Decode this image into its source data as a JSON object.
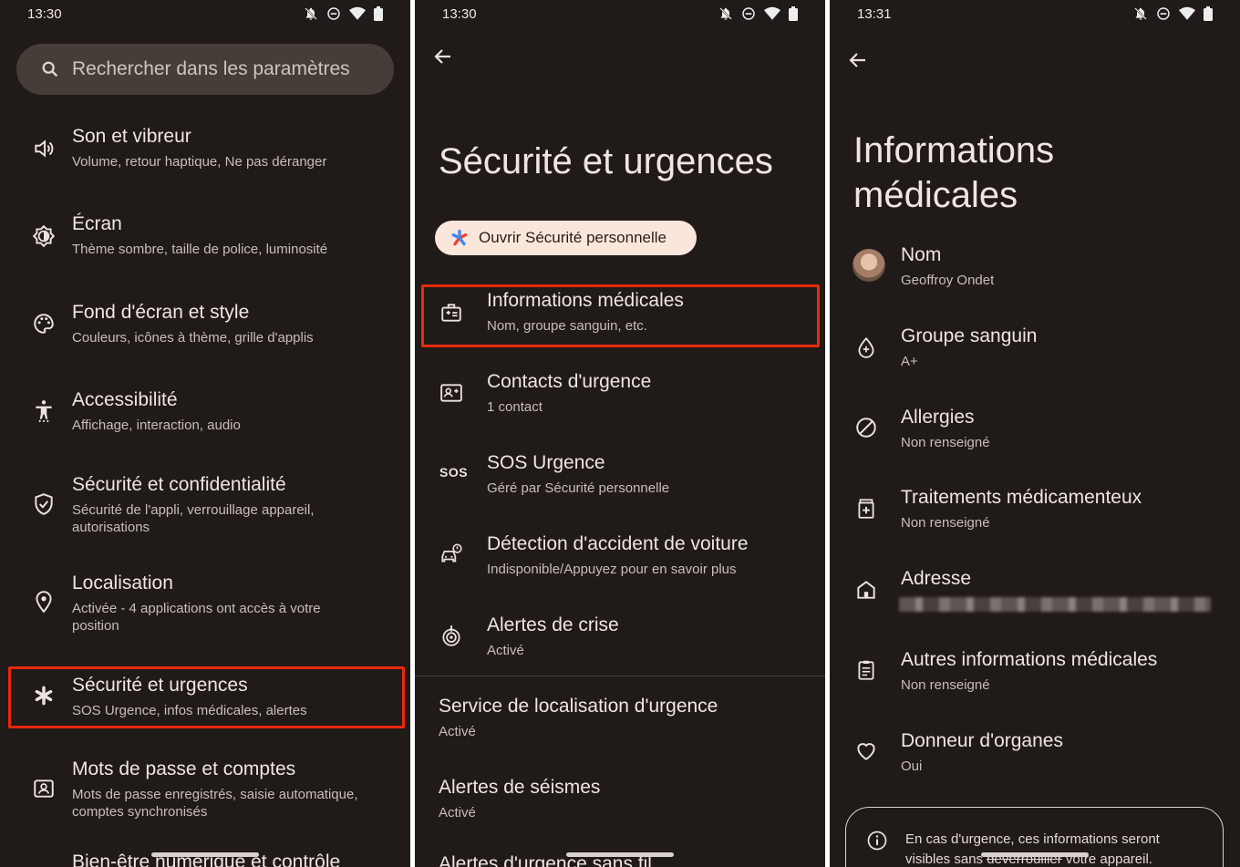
{
  "panel1": {
    "status": {
      "time": "13:30"
    },
    "search": {
      "placeholder": "Rechercher dans les paramètres"
    },
    "items": [
      {
        "title": "Son et vibreur",
        "sub": "Volume, retour haptique, Ne pas déranger",
        "icon": "volume-icon"
      },
      {
        "title": "Écran",
        "sub": "Thème sombre, taille de police, luminosité",
        "icon": "brightness-icon"
      },
      {
        "title": "Fond d'écran et style",
        "sub": "Couleurs, icônes à thème, grille d'applis",
        "icon": "palette-icon"
      },
      {
        "title": "Accessibilité",
        "sub": "Affichage, interaction, audio",
        "icon": "accessibility-icon"
      },
      {
        "title": "Sécurité et confidentialité",
        "sub": "Sécurité de l'appli, verrouillage appareil,",
        "sub2": "autorisations",
        "icon": "shield-icon"
      },
      {
        "title": "Localisation",
        "sub": "Activée - 4 applications ont accès à votre",
        "sub2": "position",
        "icon": "location-icon"
      },
      {
        "title": "Sécurité et urgences",
        "sub": "SOS Urgence, infos médicales, alertes",
        "icon": "asterisk-icon"
      },
      {
        "title": "Mots de passe et comptes",
        "sub": "Mots de passe enregistrés, saisie automatique,",
        "sub2": "comptes synchronisés",
        "icon": "account-box-icon"
      },
      {
        "title": "Bien-être numérique et contrôle",
        "icon": ""
      }
    ]
  },
  "panel2": {
    "status": {
      "time": "13:30"
    },
    "title": "Sécurité et urgences",
    "pill": "Ouvrir Sécurité personnelle",
    "items": [
      {
        "title": "Informations médicales",
        "sub": "Nom, groupe sanguin, etc.",
        "icon": "medical-id-icon"
      },
      {
        "title": "Contacts d'urgence",
        "sub": "1 contact",
        "icon": "contact-card-icon"
      },
      {
        "title": "SOS Urgence",
        "sub": "Géré par Sécurité personnelle",
        "icon": "sos-icon",
        "icon_text": "SOS"
      },
      {
        "title": "Détection d'accident de voiture",
        "sub": "Indisponible/Appuyez pour en savoir plus",
        "icon": "car-crash-icon"
      },
      {
        "title": "Alertes de crise",
        "sub": "Activé",
        "icon": "crisis-alert-icon"
      }
    ],
    "plain_items": [
      {
        "title": "Service de localisation d'urgence",
        "sub": "Activé"
      },
      {
        "title": "Alertes de séismes",
        "sub": "Activé"
      },
      {
        "title": "Alertes d'urgence sans fil"
      }
    ]
  },
  "panel3": {
    "status": {
      "time": "13:31"
    },
    "title_line1": "Informations",
    "title_line2": "médicales",
    "items": [
      {
        "title": "Nom",
        "sub": "Geoffroy Ondet",
        "icon": "avatar"
      },
      {
        "title": "Groupe sanguin",
        "sub": "A+",
        "icon": "blood-drop-icon"
      },
      {
        "title": "Allergies",
        "sub": "Non renseigné",
        "icon": "block-icon"
      },
      {
        "title": "Traitements médicamenteux",
        "sub": "Non renseigné",
        "icon": "medication-icon"
      },
      {
        "title": "Adresse",
        "sub": "",
        "icon": "home-icon"
      },
      {
        "title": "Autres informations médicales",
        "sub": "Non renseigné",
        "icon": "clipboard-icon"
      },
      {
        "title": "Donneur d'organes",
        "sub": "Oui",
        "icon": "heart-icon"
      }
    ],
    "info_line1": "En cas d'urgence, ces informations seront",
    "info_line2a": "visibles sans ",
    "info_line2b": "déverrouiller",
    "info_line2c": " votre appareil."
  },
  "colors": {
    "background": "#201a18",
    "highlight": "#e8290b",
    "pill": "#fbe6dc"
  }
}
